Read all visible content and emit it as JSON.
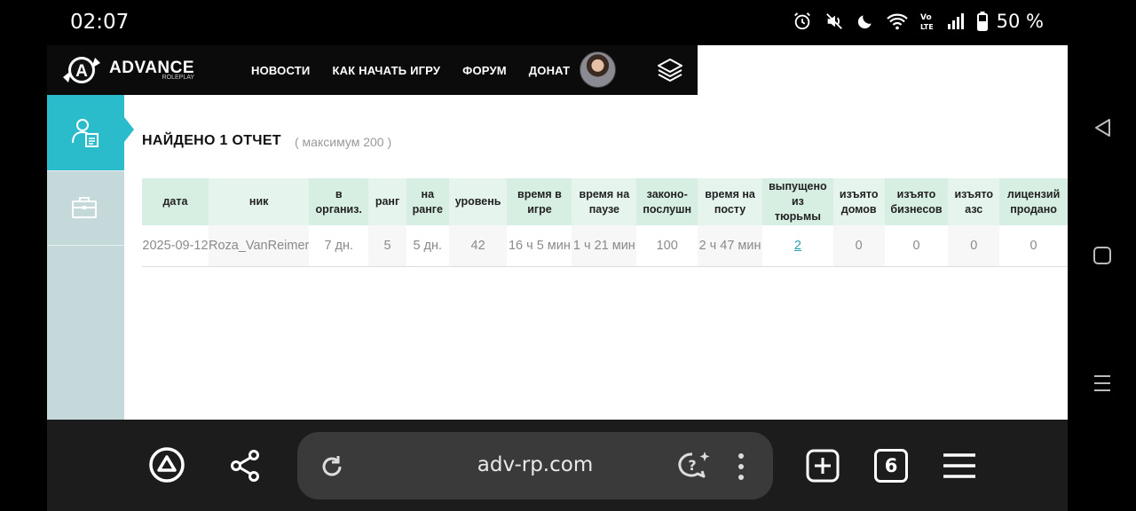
{
  "status_bar": {
    "time": "02:07",
    "battery": "50 %"
  },
  "site": {
    "logo_text": "ADVANCE",
    "logo_sub": "ROLEPLAY",
    "nav": [
      "НОВОСТИ",
      "КАК НАЧАТЬ ИГРУ",
      "ФОРУМ",
      "ДОНАТ"
    ]
  },
  "report": {
    "title": "НАЙДЕНО 1 ОТЧЕТ",
    "max_note": "( максимум 200 )",
    "headers": [
      [
        "дата"
      ],
      [
        "ник"
      ],
      [
        "в",
        "организ."
      ],
      [
        "ранг"
      ],
      [
        "на",
        "ранге"
      ],
      [
        "уровень"
      ],
      [
        "время в",
        "игре"
      ],
      [
        "время на",
        "паузе"
      ],
      [
        "законо-",
        "послушн"
      ],
      [
        "время на",
        "посту"
      ],
      [
        "выпущено",
        "из",
        "тюрьмы"
      ],
      [
        "изъято",
        "домов"
      ],
      [
        "изъято",
        "бизнесов"
      ],
      [
        "изъято",
        "азс"
      ],
      [
        "лицензий",
        "продано"
      ]
    ],
    "row": [
      "2025-09-12",
      "Roza_VanReimer",
      "7 дн.",
      "5",
      "5 дн.",
      "42",
      "16 ч 5 мин",
      "1 ч 21 мин",
      "100",
      "2 ч 47 мин",
      "2",
      "0",
      "0",
      "0",
      "0"
    ]
  },
  "browser": {
    "url": "adv-rp.com",
    "tab_count": "6"
  },
  "colors": {
    "accent": "#2bbccb",
    "sidebar": "#c6d9da",
    "header_cell": "#d7eee2"
  }
}
